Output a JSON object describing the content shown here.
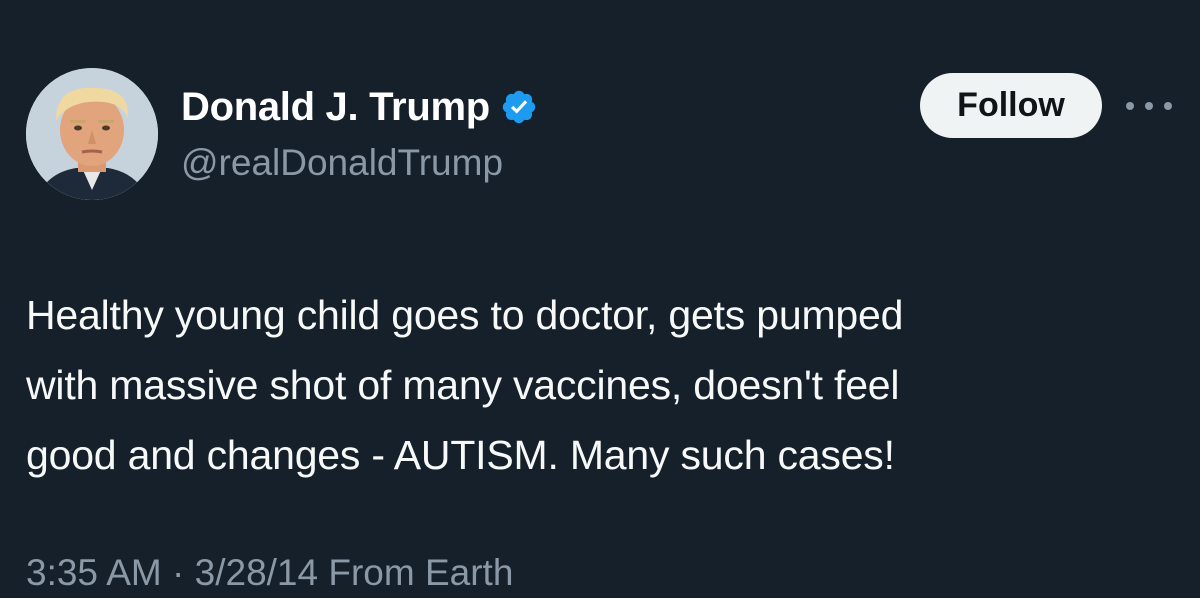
{
  "author": {
    "display_name": "Donald J. Trump",
    "handle": "@realDonaldTrump",
    "verified": true,
    "verified_badge_color": "#1d9bf0"
  },
  "actions": {
    "follow_label": "Follow",
    "more_icon": "more-horizontal-icon"
  },
  "tweet": {
    "lines": [
      "Healthy young child goes to doctor, gets pumped",
      "with massive shot of many vaccines, doesn't feel",
      "good and changes - AUTISM. Many such cases!"
    ]
  },
  "meta": {
    "partial_text": "3:35 AM · 3/28/14 From Earth"
  },
  "theme": {
    "background": "#15202b",
    "text_primary": "#ffffff",
    "text_secondary": "#8b98a5",
    "button_bg": "#eff3f4",
    "button_text": "#0f1419"
  }
}
